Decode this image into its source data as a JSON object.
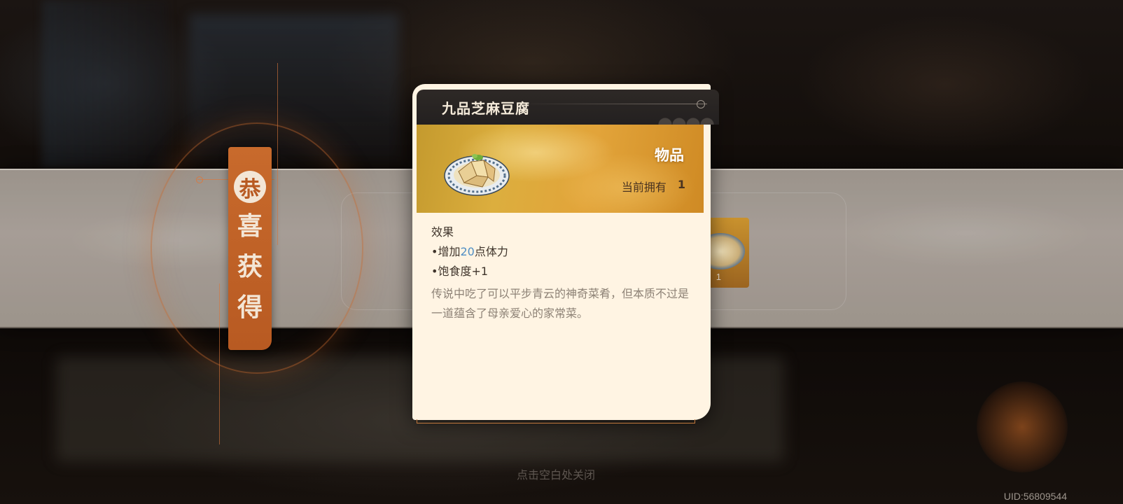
{
  "congrats": {
    "first_char": "恭",
    "chars": [
      "喜",
      "获",
      "得"
    ]
  },
  "item_card": {
    "title": "九品芝麻豆腐",
    "type_label": "物品",
    "owned_label": "当前拥有",
    "owned_count": "1",
    "effect_heading": "效果",
    "effect_1_prefix": "•增加",
    "effect_1_value": "20",
    "effect_1_suffix": "点体力",
    "effect_2": "•饱食度+1",
    "description": "传说中吃了可以平步青云的神奇菜肴，但本质不过是一道蕴含了母亲爱心的家常菜。"
  },
  "reward_slot": {
    "icon": "tofu-dish-icon",
    "count": "1"
  },
  "close_hint": "点击空白处关闭",
  "uid": "UID:56809544",
  "colors": {
    "accent_orange": "#c86a2c",
    "highlight_blue": "#4f8ec4",
    "card_bg": "#fff4e3",
    "header_dark": "#2e2926"
  }
}
